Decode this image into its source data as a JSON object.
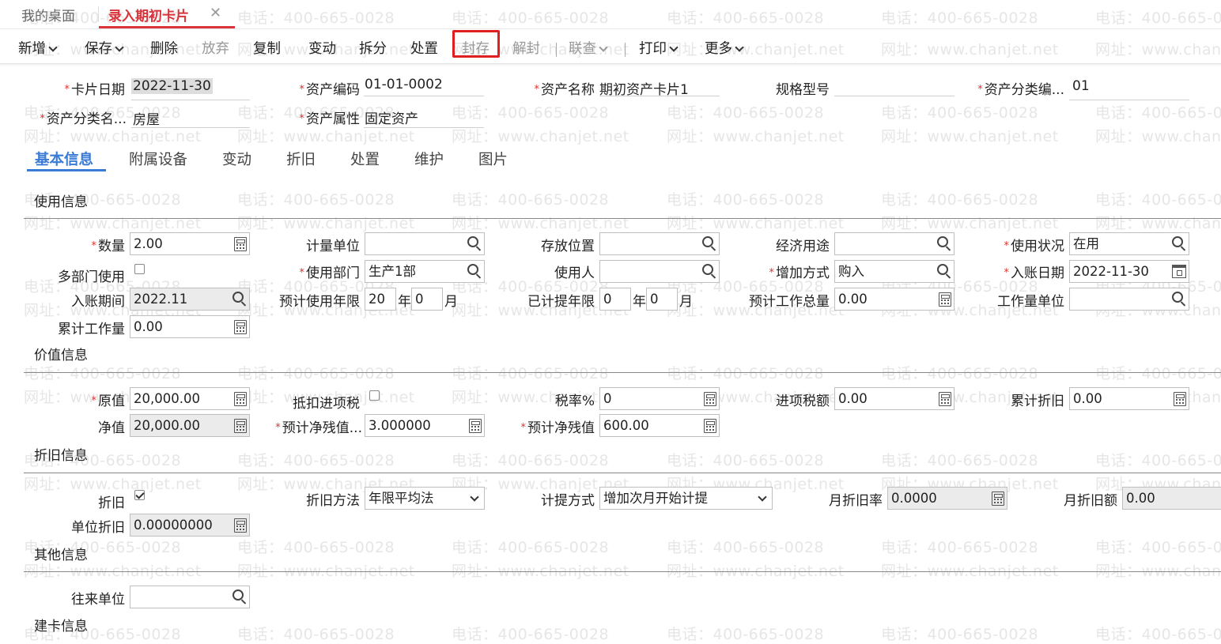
{
  "watermark": {
    "phone": "电话：400-665-0028",
    "site": "网址：www.chanjet.net"
  },
  "tabs": {
    "home": "我的桌面",
    "active": "录入期初卡片"
  },
  "toolbar": {
    "add": "新增",
    "save": "保存",
    "delete": "删除",
    "discard": "放弃",
    "copy": "复制",
    "change": "变动",
    "split": "拆分",
    "dispose": "处置",
    "seal": "封存",
    "unseal": "解封",
    "linked_query": "联查",
    "print": "打印",
    "more": "更多"
  },
  "header": {
    "card_date": {
      "label": "卡片日期",
      "value": "2022-11-30"
    },
    "asset_code": {
      "label": "资产编码",
      "value": "01-01-0002"
    },
    "asset_name": {
      "label": "资产名称",
      "value": "期初资产卡片1"
    },
    "spec_model": {
      "label": "规格型号",
      "value": ""
    },
    "category_code": {
      "label": "资产分类编...",
      "value": "01"
    },
    "category_name": {
      "label": "资产分类名...",
      "value": "房屋"
    },
    "asset_attr": {
      "label": "资产属性",
      "value": "固定资产"
    }
  },
  "section_tabs": [
    "基本信息",
    "附属设备",
    "变动",
    "折旧",
    "处置",
    "维护",
    "图片"
  ],
  "usage": {
    "title": "使用信息",
    "quantity": {
      "label": "数量",
      "value": "2.00"
    },
    "unit": {
      "label": "计量单位",
      "value": ""
    },
    "location": {
      "label": "存放位置",
      "value": ""
    },
    "economic_use": {
      "label": "经济用途",
      "value": ""
    },
    "status": {
      "label": "使用状况",
      "value": "在用"
    },
    "multi_dept": {
      "label": "多部门使用",
      "checked": false
    },
    "dept": {
      "label": "使用部门",
      "value": "生产1部"
    },
    "user": {
      "label": "使用人",
      "value": ""
    },
    "add_method": {
      "label": "增加方式",
      "value": "购入"
    },
    "entry_date": {
      "label": "入账日期",
      "value": "2022-11-30"
    },
    "entry_period": {
      "label": "入账期间",
      "value": "2022.11"
    },
    "expected_life": {
      "label": "预计使用年限",
      "years": "20",
      "months": "0"
    },
    "depreciated_life": {
      "label": "已计提年限",
      "years": "0",
      "months": "0"
    },
    "year_unit": "年",
    "month_unit": "月",
    "total_workload": {
      "label": "预计工作总量",
      "value": "0.00"
    },
    "workload_unit": {
      "label": "工作量单位",
      "value": ""
    },
    "accum_workload": {
      "label": "累计工作量",
      "value": "0.00"
    }
  },
  "value": {
    "title": "价值信息",
    "original": {
      "label": "原值",
      "value": "20,000.00"
    },
    "deduct_tax": {
      "label": "抵扣进项税",
      "checked": false
    },
    "tax_rate": {
      "label": "税率%",
      "value": "0"
    },
    "input_tax": {
      "label": "进项税额",
      "value": "0.00"
    },
    "accum_dep": {
      "label": "累计折旧",
      "value": "0.00"
    },
    "net": {
      "label": "净值",
      "value": "20,000.00"
    },
    "residual_rate": {
      "label": "预计净残值...",
      "value": "3.000000"
    },
    "residual": {
      "label": "预计净残值",
      "value": "600.00"
    }
  },
  "depreciation": {
    "title": "折旧信息",
    "depreciate": {
      "label": "折旧",
      "checked": true
    },
    "method": {
      "label": "折旧方法",
      "value": "年限平均法"
    },
    "accrual": {
      "label": "计提方式",
      "value": "增加次月开始计提"
    },
    "monthly_rate": {
      "label": "月折旧率",
      "value": "0.0000"
    },
    "monthly_amount": {
      "label": "月折旧额",
      "value": "0.00"
    },
    "unit_dep": {
      "label": "单位折旧",
      "value": "0.00000000"
    }
  },
  "other": {
    "title": "其他信息",
    "partner": {
      "label": "往来单位",
      "value": ""
    }
  },
  "card_info": {
    "title": "建卡信息"
  }
}
